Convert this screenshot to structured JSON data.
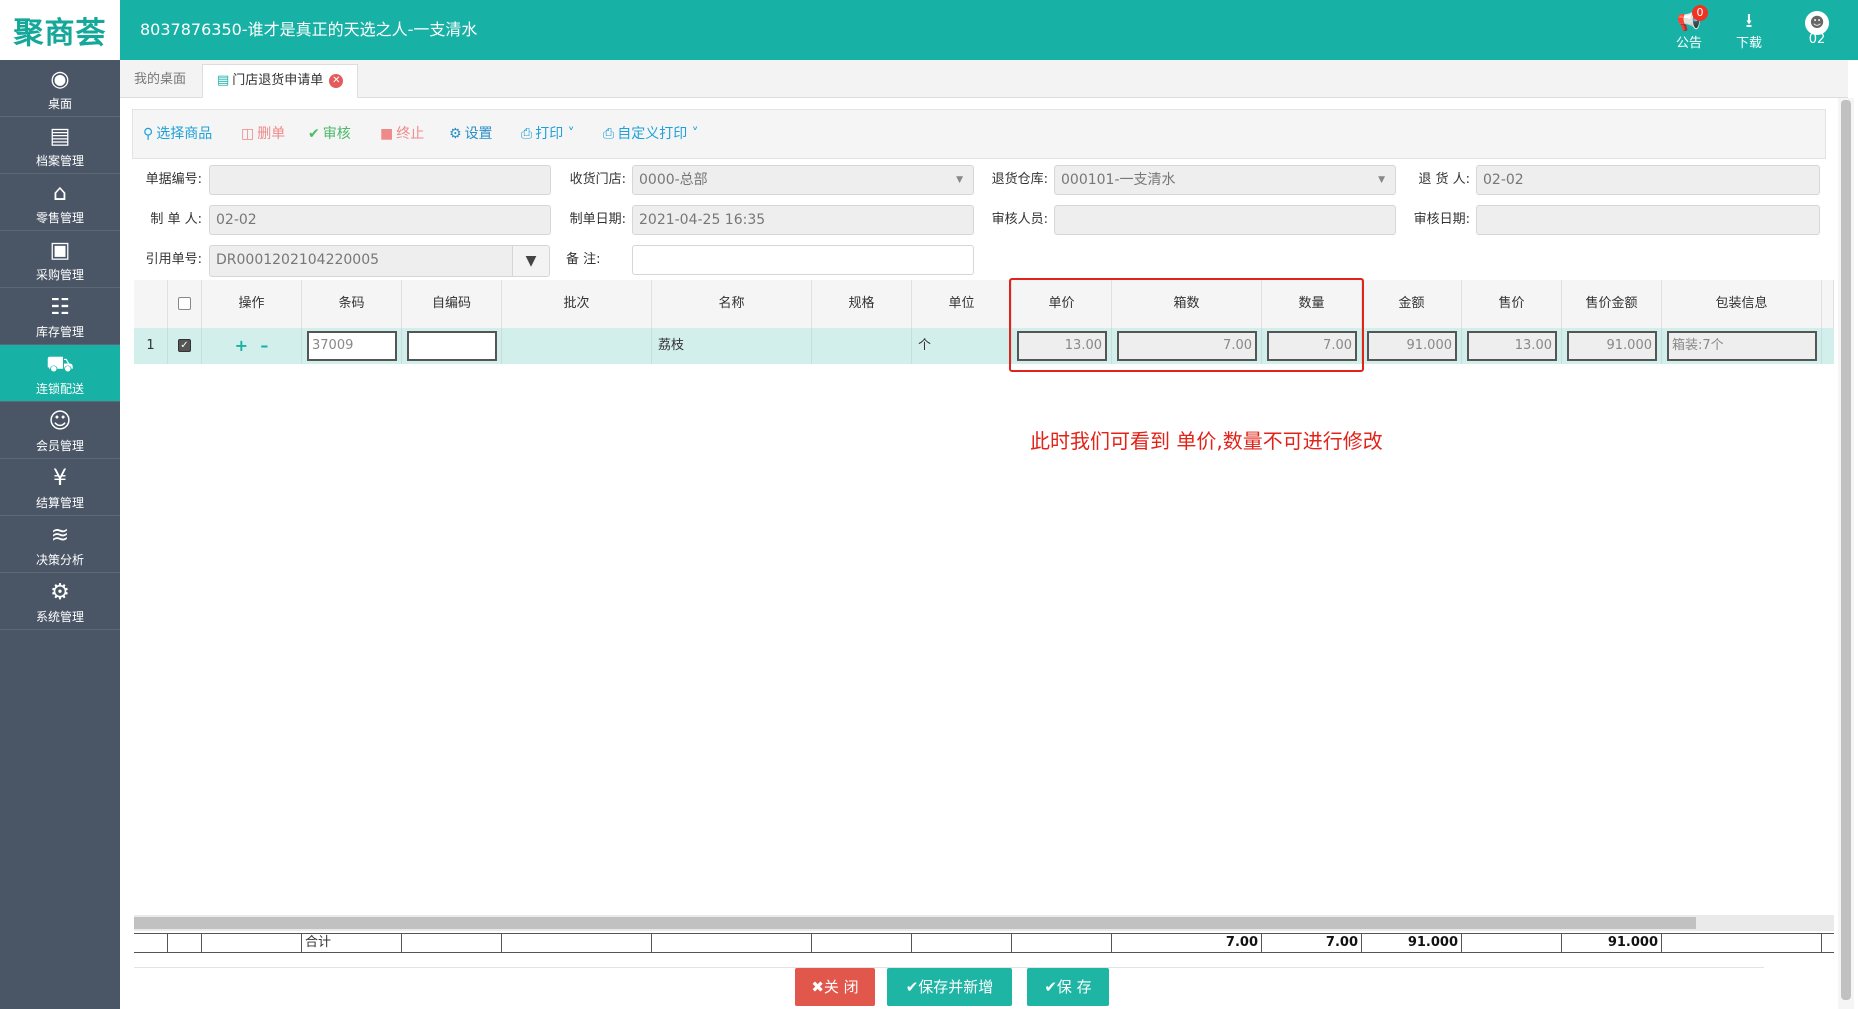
{
  "header": {
    "logo": "聚商荟",
    "title": "8037876350-谁才是真正的天选之人-一支清水",
    "notice_label": "公告",
    "notice_badge": "0",
    "download_label": "下载",
    "user_label": "02"
  },
  "sidebar": {
    "items": [
      {
        "label": "桌面",
        "icon": "dashboard-icon"
      },
      {
        "label": "档案管理",
        "icon": "archive-icon"
      },
      {
        "label": "零售管理",
        "icon": "store-icon"
      },
      {
        "label": "采购管理",
        "icon": "purchase-icon"
      },
      {
        "label": "库存管理",
        "icon": "inventory-icon"
      },
      {
        "label": "连锁配送",
        "icon": "truck-icon"
      },
      {
        "label": "会员管理",
        "icon": "member-icon"
      },
      {
        "label": "结算管理",
        "icon": "settlement-icon"
      },
      {
        "label": "决策分析",
        "icon": "chart-icon"
      },
      {
        "label": "系统管理",
        "icon": "gear-icon"
      }
    ],
    "active_index": 5
  },
  "tabs": [
    {
      "label": "我的桌面"
    },
    {
      "label": "门店退货申请单"
    }
  ],
  "toolbar": {
    "select_goods": "选择商品",
    "delete": "删单",
    "audit": "审核",
    "terminate": "终止",
    "settings": "设置",
    "print": "打印",
    "custom_print": "自定义打印"
  },
  "form": {
    "doc_no_label": "单据编号:",
    "doc_no_value": "",
    "receive_store_label": "收货门店:",
    "receive_store_value": "0000-总部",
    "return_wh_label": "退货仓库:",
    "return_wh_value": "000101-一支清水",
    "returner_label": "退 货 人:",
    "returner_value": "02-02",
    "creator_label": "制 单 人:",
    "creator_value": "02-02",
    "create_date_label": "制单日期:",
    "create_date_value": "2021-04-25 16:35",
    "auditor_label": "审核人员:",
    "auditor_value": "",
    "audit_date_label": "审核日期:",
    "audit_date_value": "",
    "ref_no_label": "引用单号:",
    "ref_no_value": "DR0001202104220005",
    "remark_label": "备    注:",
    "remark_value": ""
  },
  "grid": {
    "headers": {
      "op": "操作",
      "barcode": "条码",
      "selfcode": "自编码",
      "batch": "批次",
      "name": "名称",
      "spec": "规格",
      "unit": "单位",
      "price": "单价",
      "boxes": "箱数",
      "qty": "数量",
      "amount": "金额",
      "sale_price": "售价",
      "sale_amount": "售价金额",
      "pack": "包装信息"
    },
    "row": {
      "index": "1",
      "barcode": "37009",
      "selfcode": "",
      "batch": "",
      "name": "荔枝",
      "spec": "",
      "unit": "个",
      "price": "13.00",
      "boxes": "7.00",
      "qty": "7.00",
      "amount": "91.000",
      "sale_price": "13.00",
      "sale_amount": "91.000",
      "pack": "箱装:7个"
    },
    "footer": {
      "label": "合计",
      "boxes": "7.00",
      "qty": "7.00",
      "amount": "91.000",
      "sale_amount": "91.000"
    }
  },
  "annotation": "此时我们可看到 单价,数量不可进行修改",
  "buttons": {
    "close": "关 闭",
    "save_new": "保存并新增",
    "save": "保 存"
  },
  "colors": {
    "brand": "#17b2a5",
    "sidebar": "#4a5566",
    "highlight": "#e2231a"
  }
}
